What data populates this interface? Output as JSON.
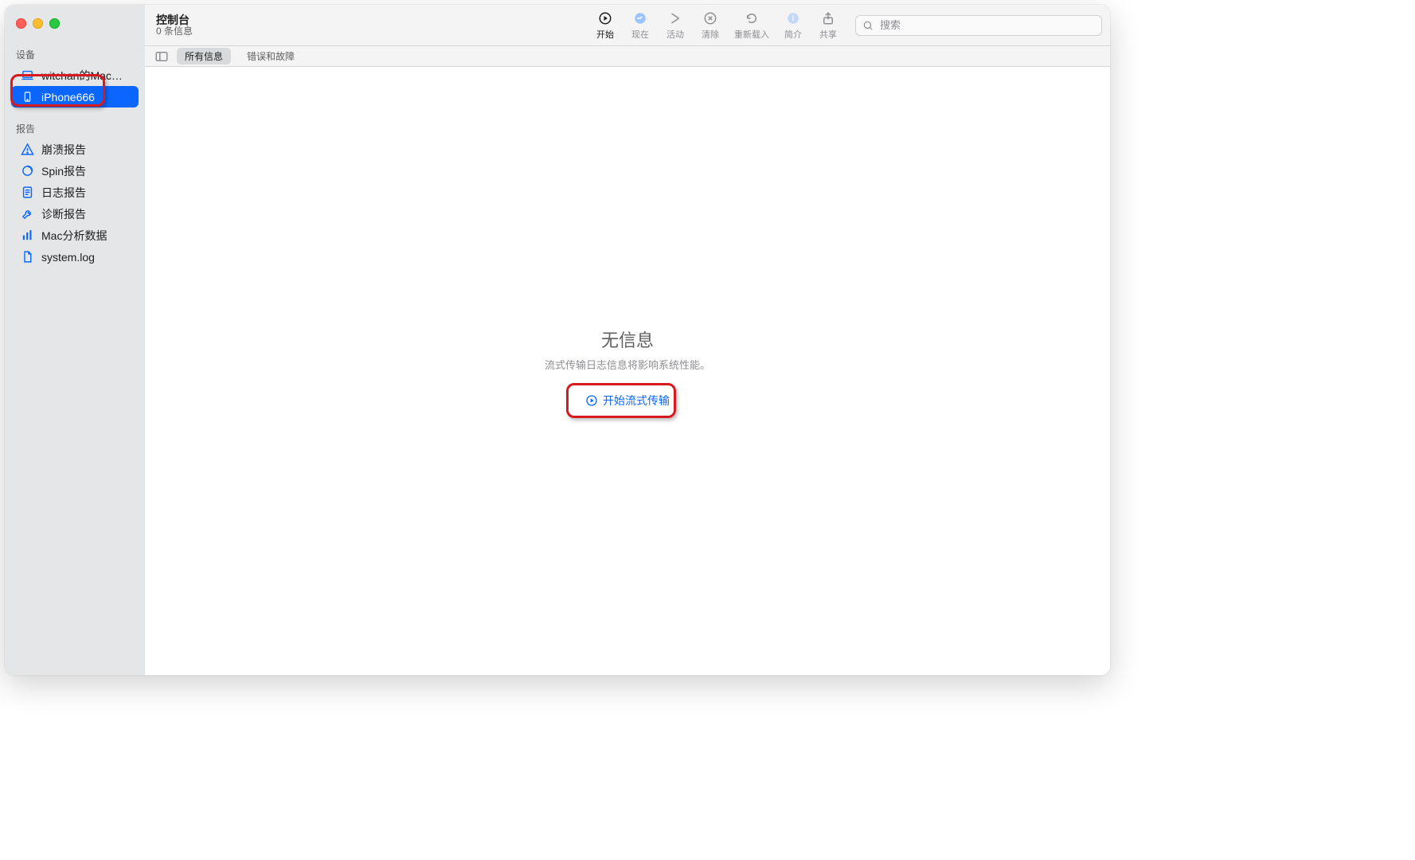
{
  "window": {
    "title": "控制台",
    "subtitle": "0 条信息"
  },
  "sidebar": {
    "devices_label": "设备",
    "devices": [
      {
        "label": "witchan的MacBo…",
        "selected": false,
        "icon": "laptop"
      },
      {
        "label": "iPhone666",
        "selected": true,
        "icon": "phone"
      }
    ],
    "reports_label": "报告",
    "reports": [
      {
        "label": "崩溃报告",
        "icon": "warning"
      },
      {
        "label": "Spin报告",
        "icon": "spinner"
      },
      {
        "label": "日志报告",
        "icon": "doc-list"
      },
      {
        "label": "诊断报告",
        "icon": "wrench"
      },
      {
        "label": "Mac分析数据",
        "icon": "bars"
      },
      {
        "label": "system.log",
        "icon": "doc"
      }
    ]
  },
  "toolbar": {
    "buttons": [
      {
        "label": "开始",
        "icon": "play",
        "active": true
      },
      {
        "label": "现在",
        "icon": "now",
        "active": false
      },
      {
        "label": "活动",
        "icon": "activity",
        "active": false
      },
      {
        "label": "清除",
        "icon": "clear",
        "active": false
      },
      {
        "label": "重新载入",
        "icon": "reload",
        "active": false
      },
      {
        "label": "简介",
        "icon": "info",
        "active": false
      },
      {
        "label": "共享",
        "icon": "share",
        "active": false
      }
    ],
    "search_placeholder": "搜索"
  },
  "filterbar": {
    "items": [
      {
        "label": "所有信息",
        "style": "pill"
      },
      {
        "label": "错误和故障",
        "style": "plain"
      }
    ]
  },
  "empty_state": {
    "heading": "无信息",
    "message": "流式传输日志信息将影响系统性能。",
    "action_label": "开始流式传输"
  }
}
